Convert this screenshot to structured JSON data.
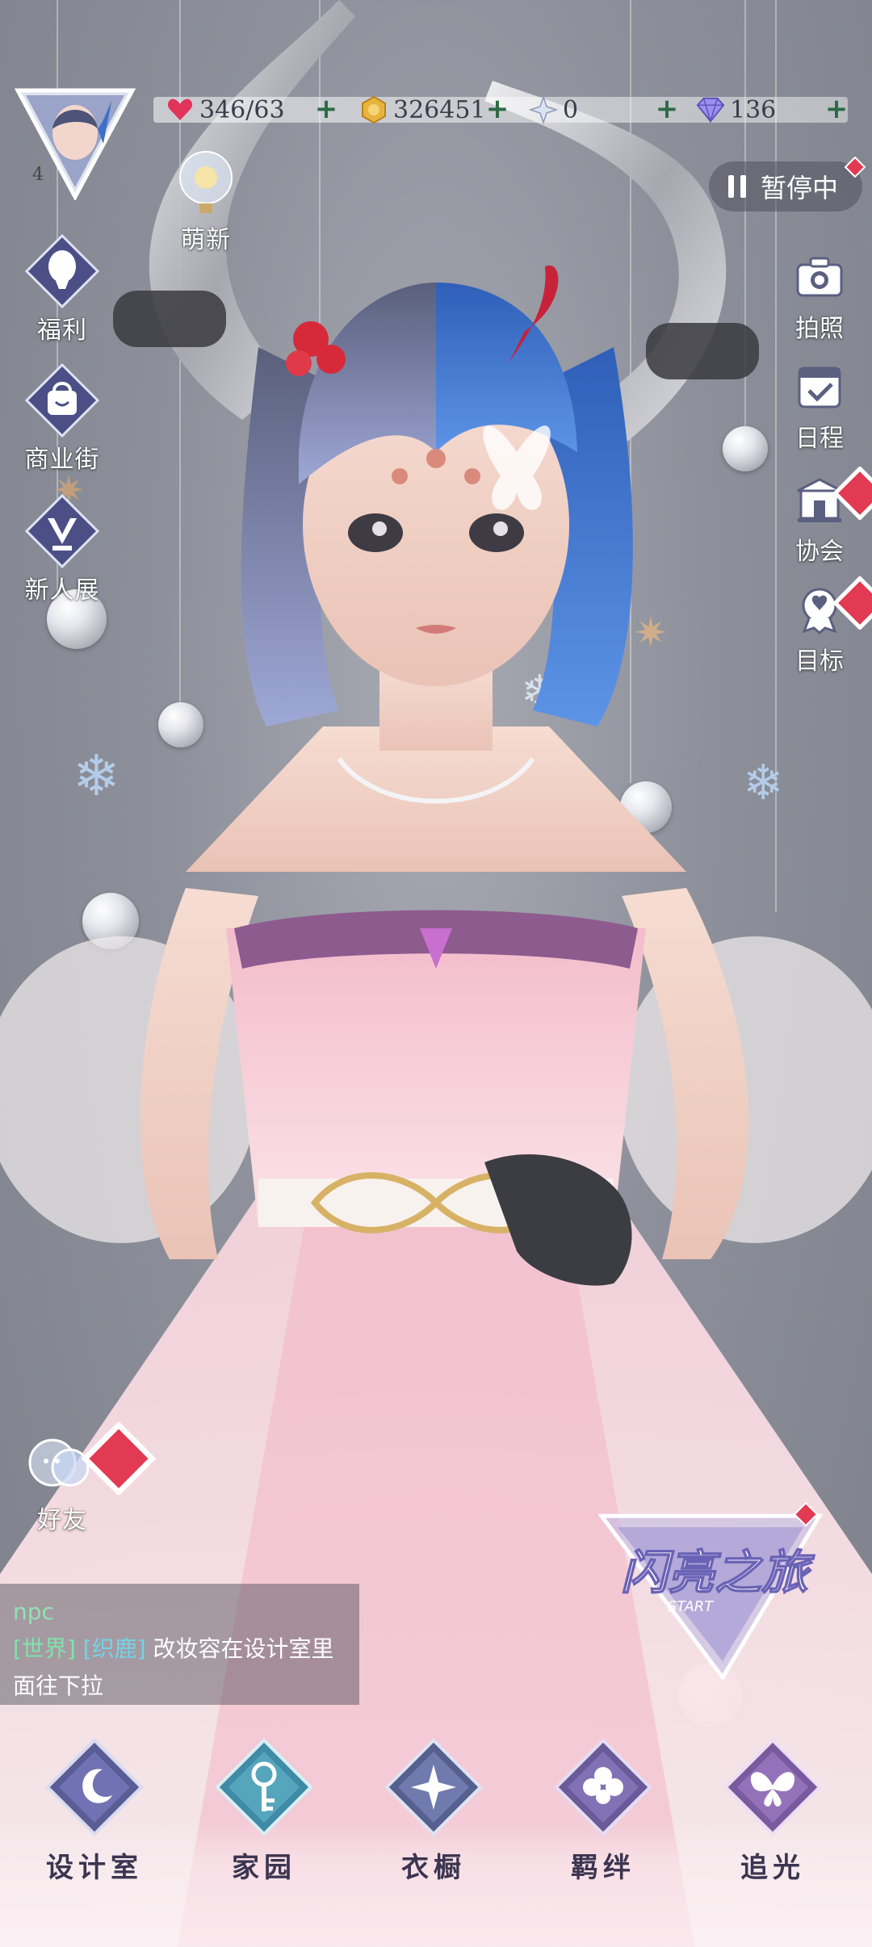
{
  "resources": [
    {
      "icon": "heart-energy-icon",
      "value": "346/63",
      "color": "#e0345a"
    },
    {
      "icon": "gold-coin-icon",
      "value": "326451",
      "color": "#e7b43d"
    },
    {
      "icon": "crystal-icon",
      "value": "0",
      "color": "#c8d4ee"
    },
    {
      "icon": "diamond-icon",
      "value": "136",
      "color": "#8c7ee0"
    }
  ],
  "player": {
    "level": "4"
  },
  "left_menu": {
    "new_player": "萌新",
    "welfare": "福利",
    "shopping_street": "商业街",
    "newcomer_show": "新人展",
    "friends": "好友"
  },
  "pause_label": "暂停中",
  "right_menu": {
    "photo": "拍照",
    "schedule": "日程",
    "guild": "协会",
    "goal": "目标"
  },
  "chat": {
    "line1": "npc",
    "channel": "[世界]",
    "sender": "[织鹿]",
    "message": "改妆容在设计室里",
    "line3": "面往下拉"
  },
  "event_banner": {
    "title": "闪亮之旅",
    "subtitle": "START"
  },
  "bottom_nav": [
    {
      "label": "设计室",
      "icon": "design-studio-icon"
    },
    {
      "label": "家园",
      "icon": "home-key-icon"
    },
    {
      "label": "衣橱",
      "icon": "wardrobe-icon"
    },
    {
      "label": "羁绊",
      "icon": "bond-clover-icon"
    },
    {
      "label": "追光",
      "icon": "butterfly-icon"
    }
  ],
  "colors": {
    "accent": "#e0345a",
    "nav_text": "#3b3550",
    "chat_green": "#7fe3ac"
  }
}
